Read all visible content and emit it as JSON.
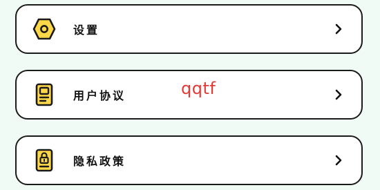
{
  "menu": {
    "items": [
      {
        "label": "设置",
        "icon": "settings-hexagon-icon"
      },
      {
        "label": "用户协议",
        "icon": "user-agreement-document-icon"
      },
      {
        "label": "隐私政策",
        "icon": "privacy-lock-document-icon"
      }
    ],
    "chevron_icon": "chevron-right-icon"
  },
  "overlay": {
    "text": "qqtf",
    "color": "#e53935"
  },
  "colors": {
    "background": "#f1fbf5",
    "icon_fill": "#ffd84a",
    "border": "#1a1a1a"
  }
}
